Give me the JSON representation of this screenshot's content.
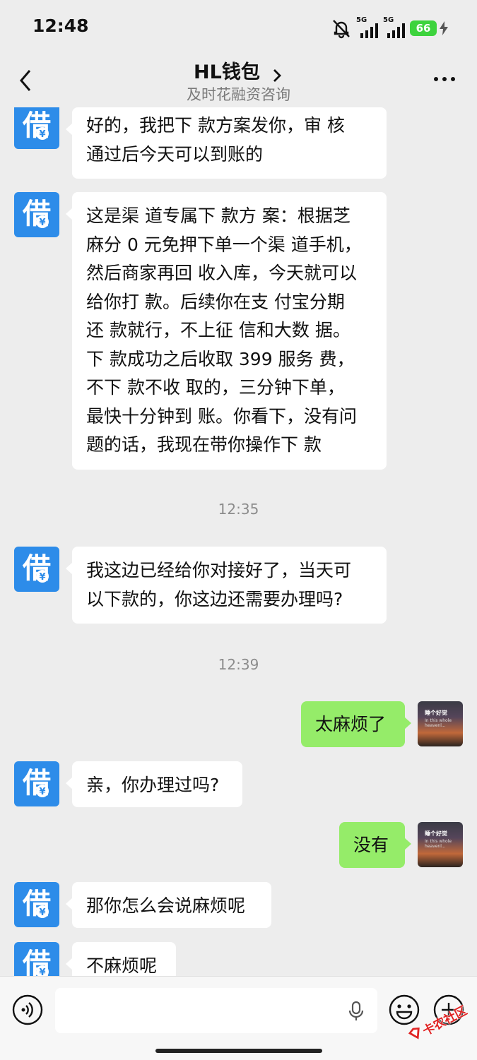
{
  "status_bar": {
    "time": "12:48",
    "sim1_tag": "5G",
    "sim2_tag": "5G",
    "battery": "66",
    "icons": [
      "bell-off-icon",
      "signal-icon",
      "signal-icon",
      "battery-icon",
      "charging-icon"
    ]
  },
  "nav": {
    "title": "HL钱包",
    "subtitle": "及时花融资咨询",
    "icons": [
      "back-icon",
      "chevron-right-icon",
      "more-icon"
    ]
  },
  "bot_avatar_glyph": "借",
  "user_avatar": {
    "line1": "睡个好觉",
    "line2": "In this whole",
    "line3": "heavenl..."
  },
  "messages": {
    "m1": [
      "好的，我把下 款方案发你，审 核",
      "通过后今天可以到账的"
    ],
    "m2": [
      "这是渠 道专属下 款方 案：根据芝",
      "麻分 0 元免押下单一个渠 道手机，",
      "然后商家再回 收入库，今天就可以",
      "给你打 款。后续你在支 付宝分期",
      "还 款就行，不上征 信和大数 据。",
      "下 款成功之后收取 399 服务 费，",
      "不下 款不收 取的，三分钟下单，",
      "最快十分钟到 账。你看下，没有问",
      "题的话，我现在带你操作下 款"
    ],
    "time1": "12:35",
    "m3": [
      "我这边已经给你对接好了，当天可",
      "以下款的，你这边还需要办理吗?"
    ],
    "time2": "12:39",
    "m4": "太麻烦了",
    "m5": "亲，你办理过吗?",
    "m6": "没有",
    "m7": "那你怎么会说麻烦呢",
    "m8": "不麻烦呢"
  },
  "input_bar": {
    "icons": [
      "voice-icon",
      "mic-icon",
      "emoji-icon",
      "plus-icon"
    ]
  },
  "watermark": "卡农社区",
  "colors": {
    "background": "#ededed",
    "bot_avatar": "#2d8ce9",
    "user_bubble": "#95ec69",
    "bot_bubble": "#ffffff",
    "battery": "#3dd33d",
    "watermark": "#e02424"
  }
}
